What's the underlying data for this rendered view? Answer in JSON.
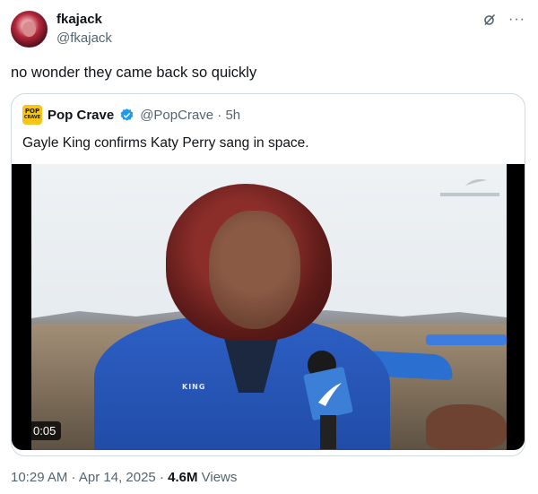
{
  "tweet": {
    "display_name": "fkajack",
    "handle": "@fkajack",
    "text": "no wonder they came back so quickly",
    "more_label": "···"
  },
  "quote": {
    "logo_text_top": "POP",
    "logo_text_bottom": "CRAVE",
    "display_name": "Pop Crave",
    "handle_time": "@PopCrave · 5h",
    "text": "Gayle King confirms Katy Perry sang in space.",
    "video": {
      "duration": "0:05",
      "name_tag": "KING"
    }
  },
  "meta": {
    "timestamp": "10:29 AM · Apr 14, 2025 · ",
    "views_count": "4.6M",
    "views_label": " Views"
  },
  "colors": {
    "verified": "#1d9bf0",
    "secondary_text": "#536471",
    "border": "#cfd9de"
  },
  "icons": [
    "grok-icon",
    "more-icon",
    "verified-badge-icon"
  ]
}
